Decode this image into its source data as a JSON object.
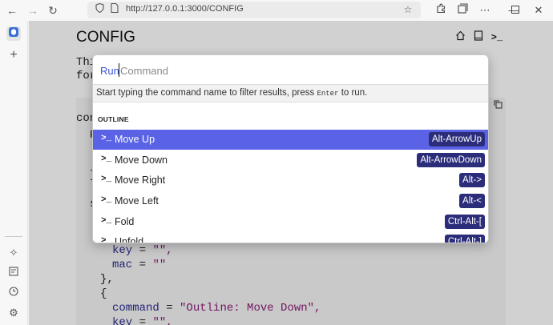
{
  "browser": {
    "url": "http://127.0.0.1:3000/CONFIG",
    "icons": {
      "back": "arrow-left-icon",
      "forward": "arrow-right-icon",
      "reload": "reload-icon",
      "shield": "shield-icon",
      "page": "page-icon",
      "star": "star-icon",
      "extensions": "puzzle-icon",
      "tabs": "tab-manager-icon",
      "more": "more-icon"
    },
    "window_controls": [
      "minimize",
      "maximize",
      "close"
    ]
  },
  "sidebar": {
    "top_icons": [
      "app-icon",
      "plus-icon"
    ],
    "bottom_icons": [
      "sparkle-icon",
      "history-tab-icon",
      "clock-icon",
      "gear-icon"
    ]
  },
  "page": {
    "title": "CONFIG",
    "intro_line1": "Thi",
    "intro_line2": "for",
    "header_icons": [
      "home-icon",
      "book-icon",
      "terminal-icon"
    ],
    "code": {
      "l1": "con",
      "l2": "P",
      "l3": "}",
      "l4": "s",
      "l5_indent": "    ",
      "l5_key": "key",
      "l5_val": "\"\",",
      "l6_key": "mac",
      "l6_val": "\"\"",
      "l7": "},",
      "l8": "{",
      "l9_key": "command",
      "l9_val": "\"Outline: Move Down\",",
      "l10_key": "key",
      "l10_val": "\"\","
    }
  },
  "palette": {
    "prefix": "Run",
    "placeholder": "Command",
    "hint_before": "Start typing the command name to filter results, press ",
    "hint_key": "Enter",
    "hint_after": " to run.",
    "section": "OUTLINE",
    "items": [
      {
        "label": "Move Up",
        "key": "Alt-ArrowUp",
        "selected": true
      },
      {
        "label": "Move Down",
        "key": "Alt-ArrowDown",
        "selected": false
      },
      {
        "label": "Move Right",
        "key": "Alt->",
        "selected": false
      },
      {
        "label": "Move Left",
        "key": "Alt-<",
        "selected": false
      },
      {
        "label": "Fold",
        "key": "Ctrl-Alt-[",
        "selected": false
      },
      {
        "label": "Unfold",
        "key": "Ctrl-Alt-]",
        "selected": false
      }
    ],
    "colors": {
      "selected_bg": "#5a63e6",
      "key_bg": "#2b2d7a",
      "prefix": "#3a55d6"
    }
  }
}
